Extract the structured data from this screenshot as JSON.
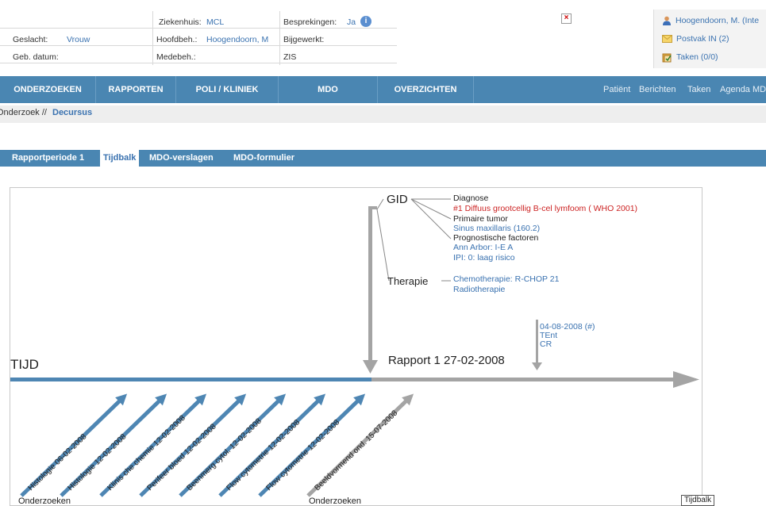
{
  "header": {
    "ziekenhuis_label": "Ziekenhuis:",
    "ziekenhuis_value": "MCL",
    "besprekingen_label": "Besprekingen:",
    "besprekingen_value": "Ja",
    "geslacht_label": "Geslacht:",
    "geslacht_value": "Vrouw",
    "hoofdbeh_label": "Hoofdbeh.:",
    "hoofdbeh_value": "Hoogendoorn, M",
    "bijgewerkt_label": "Bijgewerkt:",
    "geb_datum_label": "Geb. datum:",
    "medebeh_label": "Medebeh.:",
    "zis_label": "ZIS"
  },
  "user_panel": {
    "user": "Hoogendoorn, M. (Inte",
    "postvak": "Postvak IN (2)",
    "taken": "Taken (0/0)"
  },
  "nav": {
    "items": [
      "ONDERZOEKEN",
      "RAPPORTEN",
      "POLI / KLINIEK",
      "MDO",
      "OVERZICHTEN"
    ],
    "right_links": [
      "Patiënt",
      "Berichten",
      "Taken",
      "Agenda MD"
    ]
  },
  "breadcrumb": {
    "prefix": "Onderzoek //",
    "current": "Decursus"
  },
  "tabs": [
    "Rapportperiode 1",
    "Tijdbalk",
    "MDO-verslagen",
    "MDO-formulier"
  ],
  "timeline": {
    "axis_label": "TIJD",
    "report_label": "Rapport 1  27-02-2008",
    "gid_label": "GID",
    "therapie_label": "Therapie",
    "diagnose_header": "Diagnose",
    "diagnose_value": "#1 Diffuus grootcellig  B-cel lymfoom ( WHO 2001)",
    "primaire_header": "Primaire tumor",
    "primaire_value": "Sinus maxillaris (160.2)",
    "prognostische_header": "Prognostische factoren",
    "prognostische_values": [
      "Ann Arbor: I-E A",
      "IPI: 0: laag risico"
    ],
    "therapie_values": [
      "Chemotherapie: R-CHOP 21",
      "Radiotherapie"
    ],
    "event_lines": [
      "04-08-2008 (#)",
      "TEnt",
      "CR"
    ],
    "exam_items": [
      "Histologie 06-02-2008",
      "Histologie 12-02-2008",
      "Klinis che chemie 12-02-2008",
      "Perifeer bloed 12-02-2008",
      "Beenmerg cytol. 12-02-2008",
      "Flow cytometrie 12-02-2008",
      "Flow cytometrie 12-02-2008"
    ],
    "exam_item_after": "Beeldvormend ond. 15-07-2008",
    "onderzoeken_label_1": "Onderzoeken",
    "onderzoeken_label_2": "Onderzoeken",
    "colors": {
      "blue_arrow": "#4e86b3",
      "grey_arrow": "#a4a4a4",
      "red": "#cc2222",
      "link_blue": "#3a72b0"
    }
  },
  "tooltip": "Tijdbalk"
}
